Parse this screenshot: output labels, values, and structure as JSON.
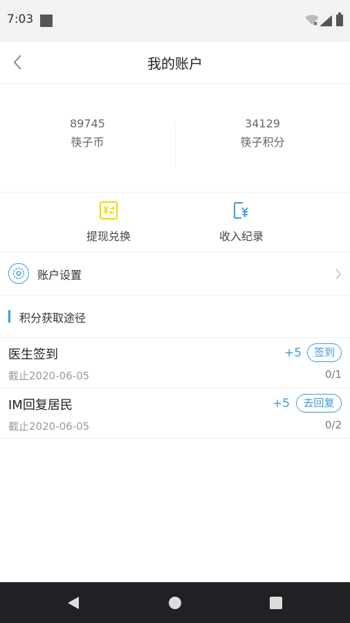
{
  "status_bar": {
    "time": "7:03"
  },
  "header": {
    "title": "我的账户"
  },
  "balance": {
    "coins": {
      "value": "89745",
      "label": "筷子币"
    },
    "points": {
      "value": "34129",
      "label": "筷子积分"
    }
  },
  "actions": [
    {
      "label": "提现兑换",
      "icon": "yuan-exchange-icon",
      "color": "#f2d600"
    },
    {
      "label": "收入纪录",
      "icon": "income-record-icon",
      "color": "#3b99e0"
    }
  ],
  "settings": {
    "label": "账户设置",
    "icon": "gear-icon"
  },
  "section": {
    "title": "积分获取途径"
  },
  "tasks": [
    {
      "name": "医生签到",
      "deadline": "截止2020-06-05",
      "points": "+5",
      "button": "签到",
      "progress": "0/1"
    },
    {
      "name": "IM回复居民",
      "deadline": "截止2020-06-05",
      "points": "+5",
      "button": "去回复",
      "progress": "0/2"
    }
  ],
  "colors": {
    "accent": "#3b99e0",
    "exchange_icon": "#f2d600",
    "nav_bar": "#1f2124"
  }
}
